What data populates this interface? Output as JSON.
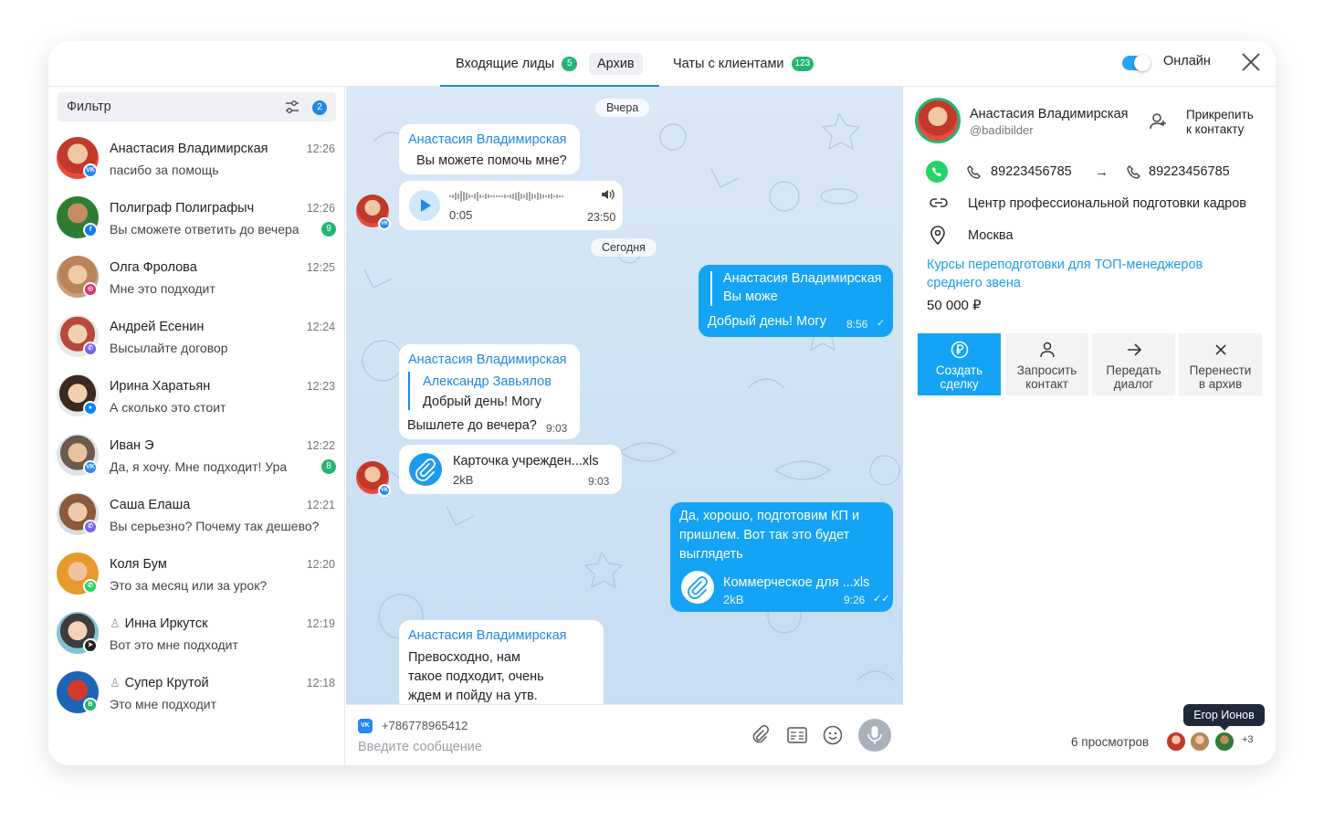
{
  "tabs": [
    {
      "label": "Входящие лиды",
      "count": "5"
    },
    {
      "label": "Архив"
    },
    {
      "label": "Чаты с клиентами",
      "count": "123"
    }
  ],
  "online_label": "Онлайн",
  "online_enabled": true,
  "filter": {
    "label": "Фильтр",
    "count": "2"
  },
  "chats": [
    {
      "name": "Анастасия Владимирская",
      "message": "пасибо за помощь",
      "time": "12:26",
      "channel": "vk",
      "unread": ""
    },
    {
      "name": "Полиграф Полиграфыч",
      "message": "Вы сможете ответить до вечера",
      "time": "12:26",
      "channel": "facebook",
      "unread": "9"
    },
    {
      "name": "Олга Фролова",
      "message": "Мне это подходит",
      "time": "12:25",
      "channel": "instagram",
      "unread": ""
    },
    {
      "name": "Андрей Есенин",
      "message": "Высылайте договор",
      "time": "12:24",
      "channel": "viber",
      "unread": ""
    },
    {
      "name": "Ирина Харатьян",
      "message": "А сколько это стоит",
      "time": "12:23",
      "channel": "messenger",
      "unread": ""
    },
    {
      "name": "Иван Э",
      "message": "Да, я хочу. Мне подходит! Ура",
      "time": "12:22",
      "channel": "vk",
      "unread": "8"
    },
    {
      "name": "Саша Елаша",
      "message": "Вы серьезно? Почему так дешево?",
      "time": "12:21",
      "channel": "viber",
      "unread": ""
    },
    {
      "name": "Коля Бум",
      "message": "Это за месяц или за урок?",
      "time": "12:20",
      "channel": "whatsapp",
      "unread": ""
    },
    {
      "name": "Инна Иркутск",
      "message": "Вот это мне подходит",
      "time": "12:19",
      "channel": "telegram",
      "unread": ""
    },
    {
      "name": "Супер Крутой",
      "message": "Это мне подходит",
      "time": "12:18",
      "channel": "green-b",
      "unread": ""
    }
  ],
  "messages": {
    "date1": "Вчера",
    "m1": {
      "sender": "Анастасия Владимирская",
      "text": "Вы можете помочь мне?"
    },
    "voice": {
      "elapsed": "0:05",
      "time": "23:50"
    },
    "date2": "Сегодня",
    "m2": {
      "quote_name": "Анастасия Владимирская",
      "quote_text": "Вы може",
      "text": "Добрый день! Могу",
      "time": "8:56"
    },
    "m3": {
      "sender": "Анастасия Владимирская",
      "quote_name": "Александр Завьялов",
      "quote_text": "Добрый день! Могу",
      "text": "Вышлете до вечера?",
      "time": "9:03"
    },
    "file1": {
      "name": "Карточка учрежден...xls",
      "size": "2kB",
      "time": "9:03"
    },
    "m4": {
      "line1": "Да, хорошо, подготовим КП и",
      "line2": "пришлем. Вот так это будет",
      "line3": "выглядеть",
      "file_name": "Коммерческое для ...xls",
      "file_size": "2kB",
      "time": "9:26"
    },
    "m5": {
      "sender": "Анастасия Владимирская",
      "line1": "Превосходно, нам",
      "line2": "такое подходит, очень",
      "line3": "ждем и пойду на утв."
    }
  },
  "composer": {
    "phone": "+786778965412",
    "placeholder": "Введите сообщение"
  },
  "contact": {
    "name": "Анастасия Владимирская",
    "username": "@badibilder",
    "attach_line1": "Прикрепить",
    "attach_line2": "к контакту",
    "phone_from": "89223456785",
    "phone_to": "89223456785",
    "company": "Центр профессиональной подготовки кадров",
    "city": "Москва",
    "deal_line1": "Курсы переподготовки для ТОП-менеджеров",
    "deal_line2": "среднего звена",
    "price": "50 000 ₽"
  },
  "actions": [
    {
      "line1": "Создать",
      "line2": "сделку"
    },
    {
      "line1": "Запросить",
      "line2": "контакт"
    },
    {
      "line1": "Передать",
      "line2": "диалог"
    },
    {
      "line1": "Перенести",
      "line2": "в архив"
    }
  ],
  "views": {
    "label": "6 просмотров",
    "extra": "+3",
    "tooltip": "Егор Ионов"
  },
  "colors": {
    "accent": "#14a3f5",
    "link": "#1e88e5",
    "success": "#22b573",
    "chat_bg": "#cfe2f4"
  }
}
